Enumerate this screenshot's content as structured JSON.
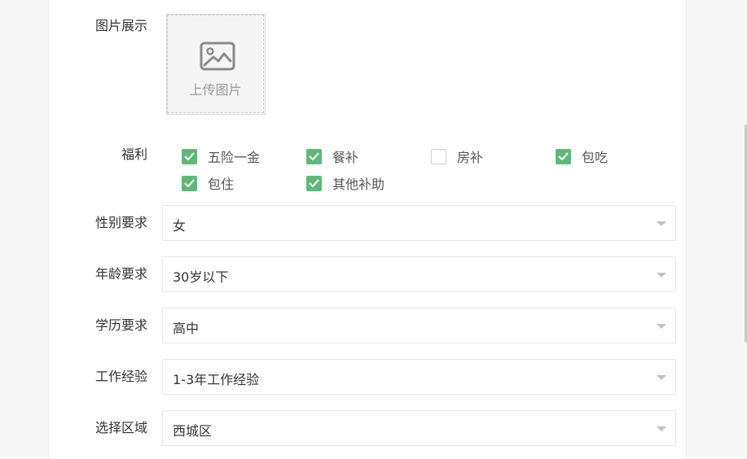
{
  "image_display": {
    "label": "图片展示",
    "upload_text": "上传图片",
    "icon": "image-icon"
  },
  "welfare": {
    "label": "福利",
    "options": [
      {
        "label": "五险一金",
        "checked": true
      },
      {
        "label": "餐补",
        "checked": true
      },
      {
        "label": "房补",
        "checked": false
      },
      {
        "label": "包吃",
        "checked": true
      },
      {
        "label": "包住",
        "checked": true
      },
      {
        "label": "其他补助",
        "checked": true
      }
    ]
  },
  "fields": [
    {
      "label": "性别要求",
      "value": "女"
    },
    {
      "label": "年龄要求",
      "value": "30岁以下"
    },
    {
      "label": "学历要求",
      "value": "高中"
    },
    {
      "label": "工作经验",
      "value": "1-3年工作经验"
    },
    {
      "label": "选择区域",
      "value": "西城区"
    }
  ],
  "colors": {
    "accent": "#5fb878",
    "border": "#e6e6e6",
    "text": "#333333"
  }
}
